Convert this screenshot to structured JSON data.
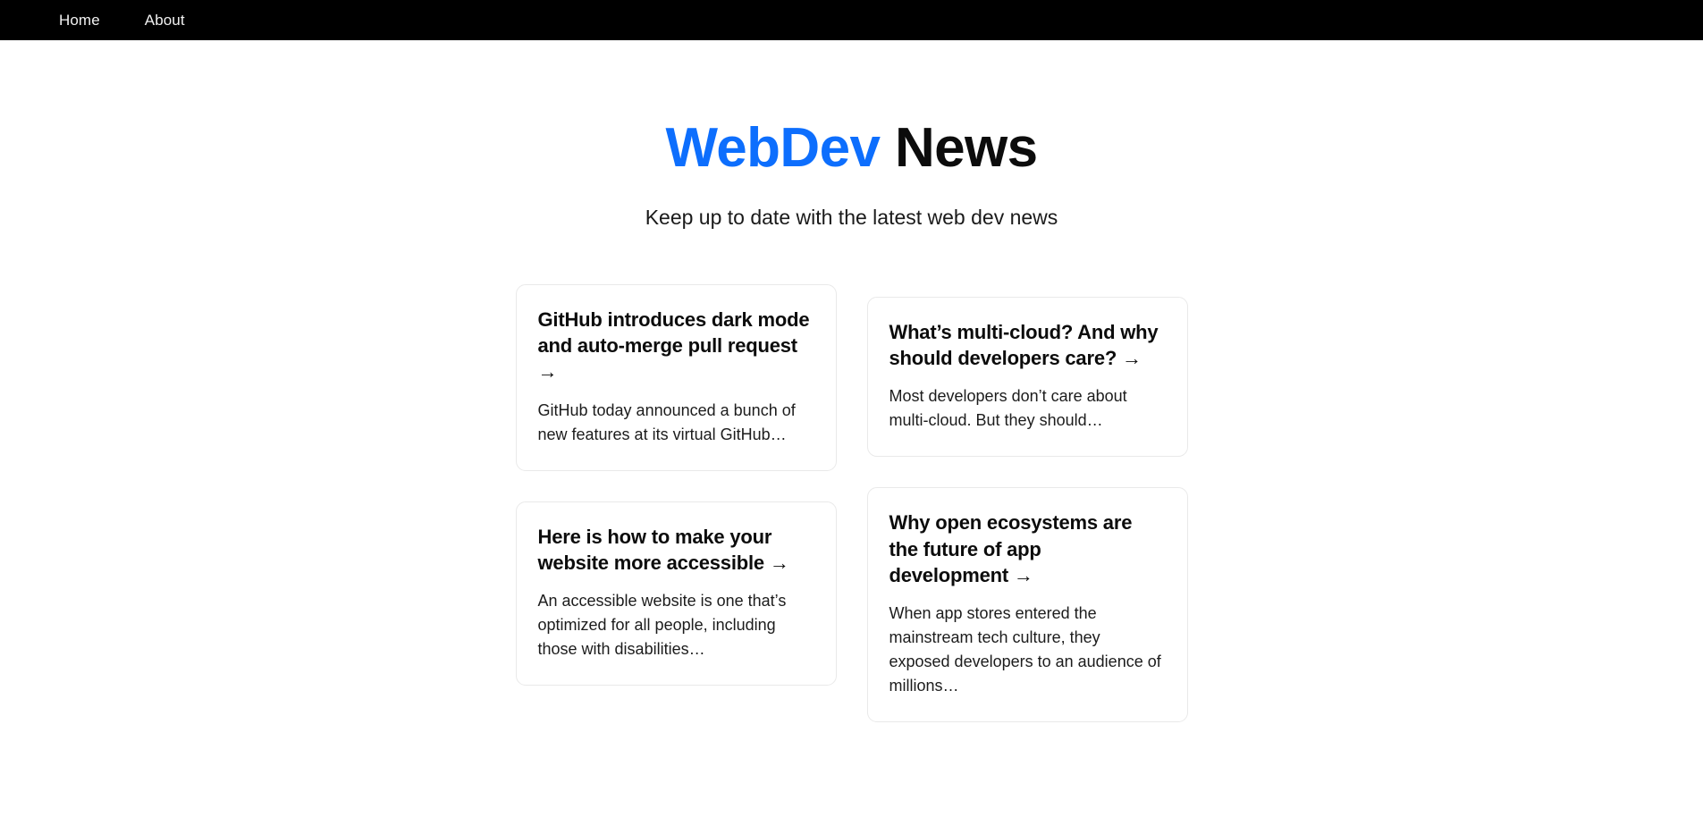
{
  "navbar": {
    "links": [
      {
        "label": "Home",
        "name": "nav-link-home"
      },
      {
        "label": "About",
        "name": "nav-link-about"
      }
    ],
    "background_color": "#000000",
    "text_color": "#f1f1f1"
  },
  "header": {
    "title_accent": "WebDev",
    "title_rest": " News",
    "accent_color": "#0d6efd",
    "tagline": "Keep up to date with the latest web dev news"
  },
  "arrow_icon": "→",
  "articles": {
    "column_left": [
      {
        "title": "GitHub introduces dark mode and auto-merge pull request ",
        "description": "GitHub today announced a bunch of new features at its virtual GitHub…"
      },
      {
        "title": "Here is how to make your website more accessible ",
        "description": "An accessible website is one that’s optimized for all people, including those with disabilities…"
      }
    ],
    "column_right": [
      {
        "title": "What’s multi-cloud? And why should developers care? ",
        "description": "Most developers don’t care about multi-cloud. But they should…"
      },
      {
        "title": "Why open ecosystems are the future of app development ",
        "description": "When app stores entered the mainstream tech culture, they exposed developers to an audience of millions…"
      }
    ]
  }
}
